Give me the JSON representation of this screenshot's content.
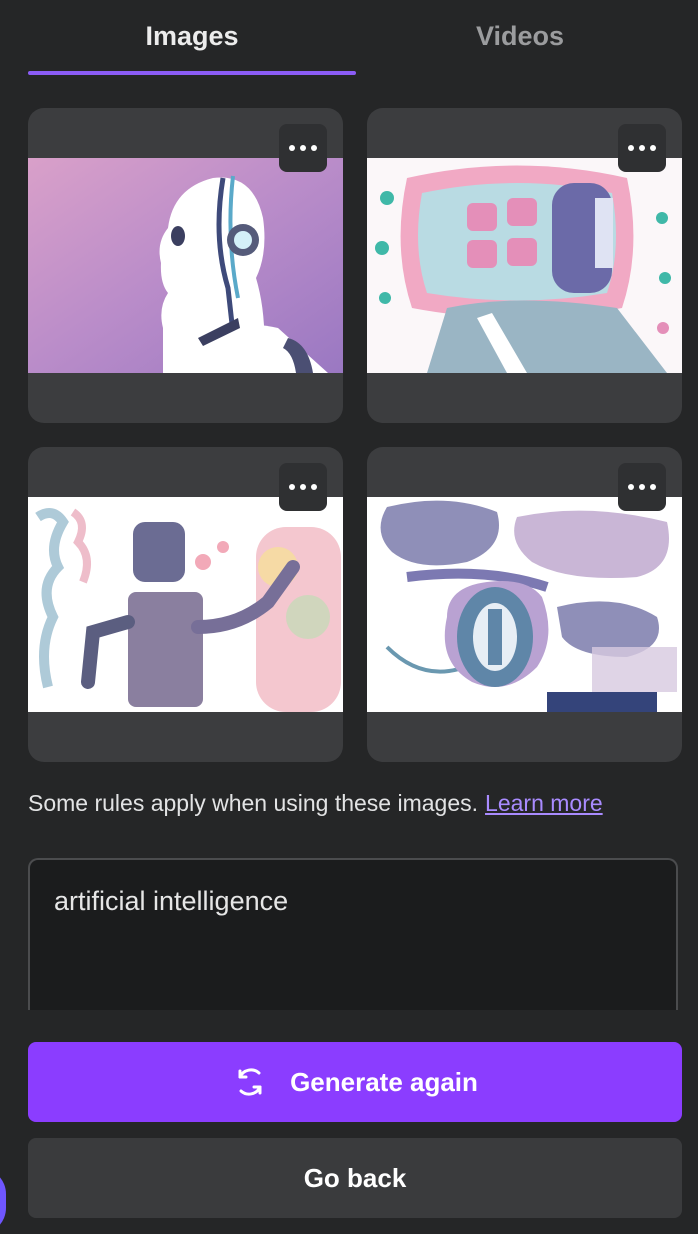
{
  "tabs": [
    {
      "label": "Images",
      "active": true
    },
    {
      "label": "Videos",
      "active": false
    }
  ],
  "results": [
    {
      "name": "generated-image-1",
      "menu_icon": "more-horizontal-icon"
    },
    {
      "name": "generated-image-2",
      "menu_icon": "more-horizontal-icon"
    },
    {
      "name": "generated-image-3",
      "menu_icon": "more-horizontal-icon"
    },
    {
      "name": "generated-image-4",
      "menu_icon": "more-horizontal-icon"
    }
  ],
  "notice": {
    "text": "Some rules apply when using these images.",
    "link": "Learn more"
  },
  "prompt": {
    "value": "artificial intelligence"
  },
  "buttons": {
    "generate": "Generate again",
    "generate_icon": "sync-icon",
    "back": "Go back"
  },
  "colors": {
    "accent": "#8b3dff",
    "tab_indicator": "#8b5cf6",
    "link": "#a98bff"
  }
}
